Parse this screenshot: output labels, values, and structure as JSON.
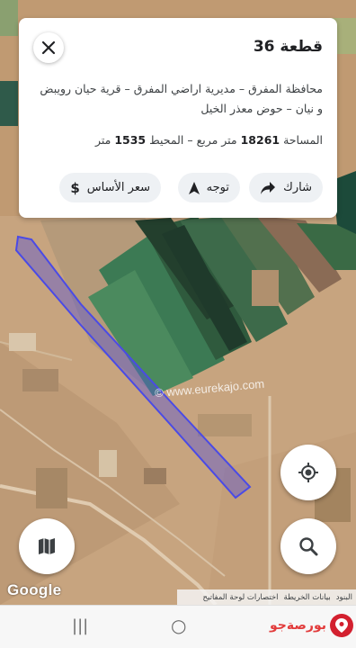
{
  "parcel": {
    "title": "قطعة 36",
    "address": "محافظة المفرق – مديرية اراضي المفرق – قرية حيان رويبض و نيان – حوض معذر الخيل",
    "area_label": "المساحة",
    "area_value": "18261",
    "area_unit": "متر مربع",
    "perimeter_label": "المحيط",
    "perimeter_value": "1535",
    "perimeter_unit": "متر"
  },
  "actions": {
    "share": "شارك",
    "direction": "توجه",
    "base_price": "سعر الأساس"
  },
  "icons": {
    "close": "close-icon",
    "share": "share-arrow-icon",
    "direction": "navigation-arrow-icon",
    "price": "dollar-icon",
    "locate": "my-location-icon",
    "layers": "map-layers-icon",
    "search": "search-icon"
  },
  "map": {
    "watermark": "© www.eurekajo.com",
    "provider_logo": "Google",
    "attribution": {
      "terms": "البنود",
      "map_data": "بيانات الخريطة",
      "shortcuts": "اختصارات لوحة المفاتيح"
    },
    "parcel_color": "#4a4ae6"
  },
  "navbar": {
    "recent": "|||",
    "home": "○",
    "back": "<",
    "brand_text": "بورصةجو"
  }
}
